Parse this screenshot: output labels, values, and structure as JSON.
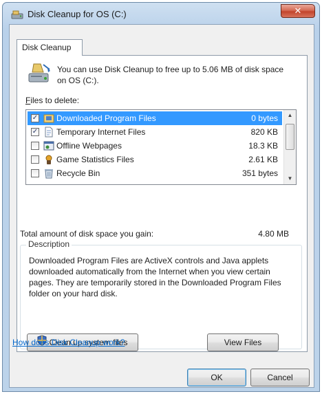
{
  "window": {
    "title": "Disk Cleanup for OS (C:)",
    "close_glyph": "✕"
  },
  "tab": {
    "label": "Disk Cleanup"
  },
  "header": {
    "message": "You can use Disk Cleanup to free up to 5.06 MB of disk space on OS (C:)."
  },
  "files": {
    "label_accel": "F",
    "label_rest": "iles to delete:",
    "items": [
      {
        "checked": true,
        "name": "Downloaded Program Files",
        "size": "0 bytes",
        "icon": "folder-download-icon"
      },
      {
        "checked": true,
        "name": "Temporary Internet Files",
        "size": "820 KB",
        "icon": "document-icon"
      },
      {
        "checked": false,
        "name": "Offline Webpages",
        "size": "18.3 KB",
        "icon": "webpage-icon"
      },
      {
        "checked": false,
        "name": "Game Statistics Files",
        "size": "2.61 KB",
        "icon": "game-controller-icon"
      },
      {
        "checked": false,
        "name": "Recycle Bin",
        "size": "351 bytes",
        "icon": "recycle-bin-icon"
      }
    ],
    "selected_index": 0,
    "check_glyph": "✓"
  },
  "total": {
    "label": "Total amount of disk space you gain:",
    "value": "4.80 MB"
  },
  "description": {
    "legend": "Description",
    "text": "Downloaded Program Files are ActiveX controls and Java applets downloaded automatically from the Internet when you view certain pages. They are temporarily stored in the Downloaded Program Files folder on your hard disk."
  },
  "buttons": {
    "cleanup_system": "Clean up system files",
    "view_files": "View Files",
    "ok": "OK",
    "cancel": "Cancel"
  },
  "help_link": "How does Disk Cleanup work?",
  "colors": {
    "selection": "#3399ff",
    "link": "#0066cc",
    "close_button": "#c2452d"
  }
}
